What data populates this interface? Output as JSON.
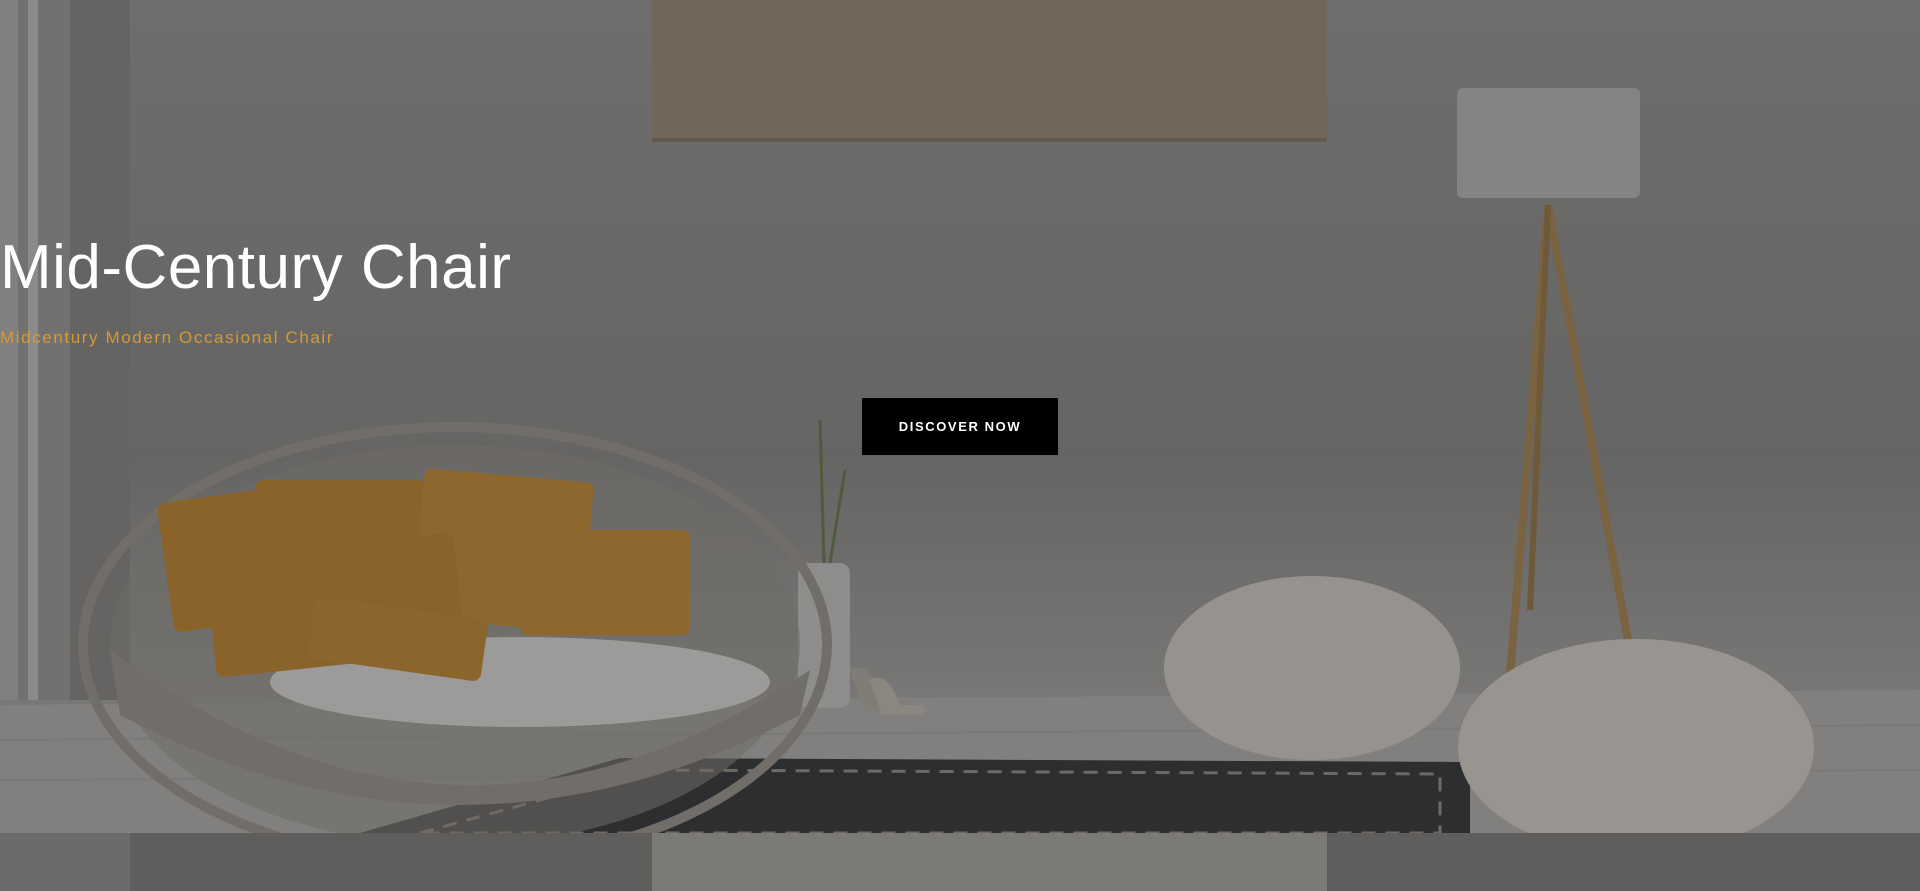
{
  "hero": {
    "title": "Mid-Century Chair",
    "subtitle": "Midcentury Modern Occasional Chair",
    "cta_label": "DISCOVER NOW"
  },
  "colors": {
    "accent": "#d39a36",
    "button_bg": "#000000",
    "text_light": "#ffffff"
  }
}
